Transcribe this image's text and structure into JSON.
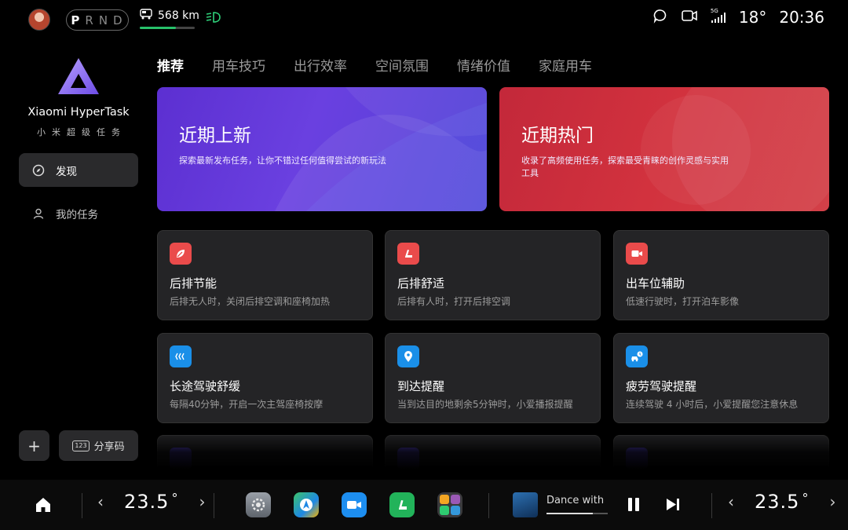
{
  "status_bar": {
    "gears": [
      "P",
      "R",
      "N",
      "D"
    ],
    "active_gear": "P",
    "range_text": "568 km",
    "range_fraction": 0.65,
    "temperature": "18°",
    "time": "20:36",
    "signal_label": "5G",
    "icons": [
      "avatar",
      "car-range-icon",
      "headlight-icon",
      "message-icon",
      "camera-icon",
      "signal-icon"
    ]
  },
  "sidebar": {
    "app_name": "Xiaomi HyperTask",
    "app_subtitle": "小米超级任务",
    "items": [
      {
        "label": "发现",
        "icon": "compass-icon",
        "active": true
      },
      {
        "label": "我的任务",
        "icon": "person-icon",
        "active": false
      }
    ],
    "add_label": "+",
    "share_icon_text": "123",
    "share_label": "分享码"
  },
  "tabs": [
    "推荐",
    "用车技巧",
    "出行效率",
    "空间氛围",
    "情绪价值",
    "家庭用车"
  ],
  "banners": [
    {
      "title": "近期上新",
      "desc": "探索最新发布任务，让你不错过任何值得尝试的新玩法",
      "color": "#5c2fd1"
    },
    {
      "title": "近期热门",
      "desc": "收录了高频使用任务，探索最受青睐的创作灵感与实用工具",
      "color": "#c3283a"
    }
  ],
  "cards": [
    {
      "title": "后排节能",
      "desc": "后排无人时，关闭后排空调和座椅加热",
      "icon": "leaf-icon",
      "color": "#ea4b4b"
    },
    {
      "title": "后排舒适",
      "desc": "后排有人时，打开后排空调",
      "icon": "seat-icon",
      "color": "#ea4b4b"
    },
    {
      "title": "出车位辅助",
      "desc": "低速行驶时，打开泊车影像",
      "icon": "video-camera-icon",
      "color": "#ea4b4b"
    },
    {
      "title": "长途驾驶舒缓",
      "desc": "每隔40分钟，开启一次主驾座椅按摩",
      "icon": "heat-waves-icon",
      "color": "#1a8fe8"
    },
    {
      "title": "到达提醒",
      "desc": "当到达目的地剩余5分钟时，小爱播报提醒",
      "icon": "location-pin-icon",
      "color": "#1a8fe8"
    },
    {
      "title": "疲劳驾驶提醒",
      "desc": "连续驾驶 4 小时后，小爱提醒您注意休息",
      "icon": "car-alert-icon",
      "color": "#1a8fe8"
    }
  ],
  "dock": {
    "left_temp": "23.5",
    "right_temp": "23.5",
    "degree": "°",
    "apps": [
      "settings-app-icon",
      "navigation-app-icon",
      "video-call-app-icon",
      "seat-app-icon",
      "app-group-icon"
    ],
    "song": "Dance with",
    "song_progress": 0.75
  }
}
